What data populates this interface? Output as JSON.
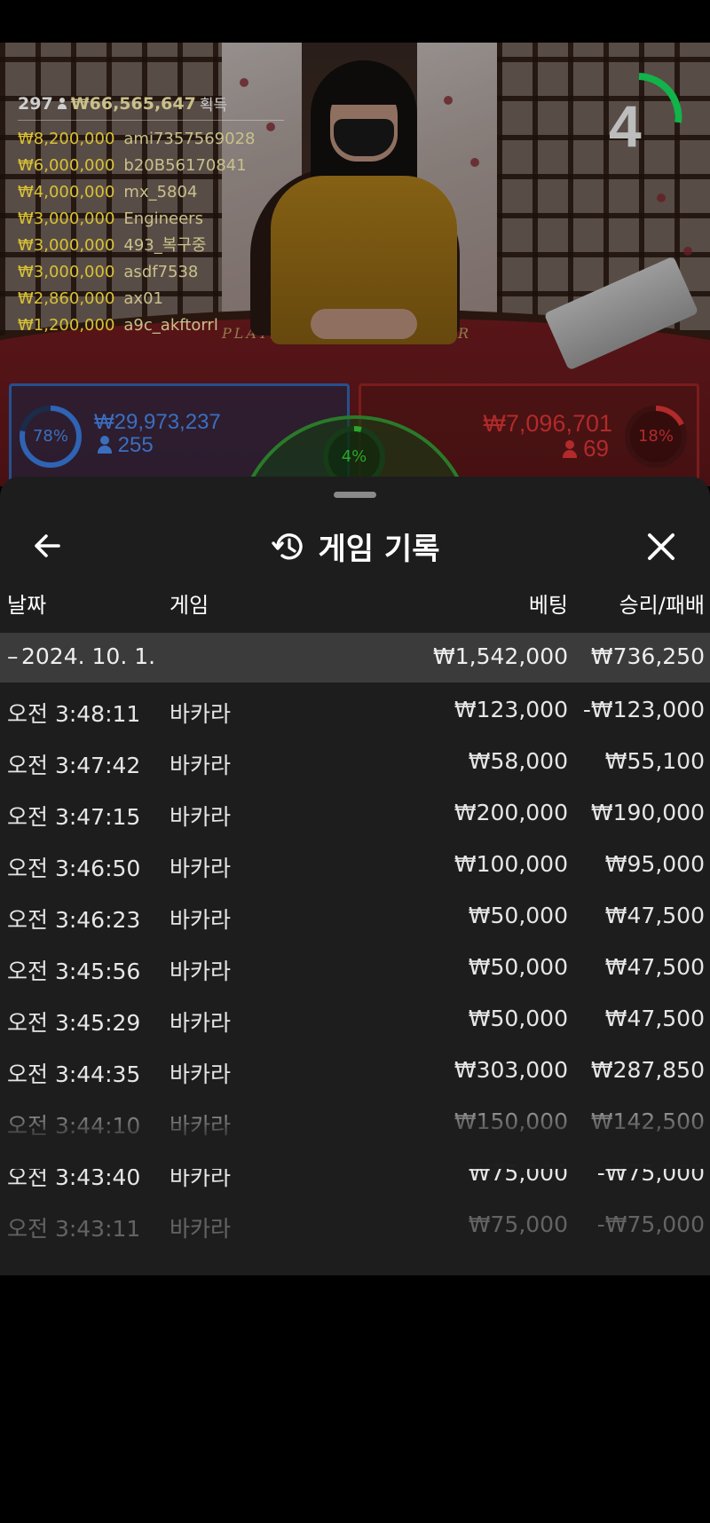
{
  "live": {
    "winners_summary": {
      "count": "297",
      "total": "₩66,565,647",
      "label": "획득"
    },
    "winners": [
      {
        "amount": "₩8,200,000",
        "user": "ami7357569028"
      },
      {
        "amount": "₩6,000,000",
        "user": "b20B56170841"
      },
      {
        "amount": "₩4,000,000",
        "user": "mx_5804"
      },
      {
        "amount": "₩3,000,000",
        "user": "Engineers"
      },
      {
        "amount": "₩3,000,000",
        "user": "493_복구중"
      },
      {
        "amount": "₩3,000,000",
        "user": "asdf7538"
      },
      {
        "amount": "₩2,860,000",
        "user": "ax01"
      },
      {
        "amount": "₩1,200,000",
        "user": "a9c_akftorrl"
      }
    ],
    "countdown": "4",
    "table_labels": {
      "player": "PLAYER",
      "banker": "BANKER"
    },
    "player": {
      "percent": "78%",
      "percent_value": 78,
      "amount": "₩29,973,237",
      "count": "255",
      "color": "#2f63b3"
    },
    "tie": {
      "percent": "4%",
      "percent_value": 4,
      "color": "#2aa52a"
    },
    "banker": {
      "percent": "18%",
      "percent_value": 18,
      "amount": "₩7,096,701",
      "count": "69",
      "color": "#b22a2a"
    }
  },
  "sheet": {
    "title": "게임 기록",
    "icons": {
      "back": "arrow-left-icon",
      "history": "history-icon",
      "close": "close-icon"
    },
    "columns": {
      "date": "날짜",
      "game": "게임",
      "bet": "베팅",
      "result": "승리/패배"
    },
    "date_group": {
      "toggle": "–",
      "date": "2024. 10. 1.",
      "bet_total": "₩1,542,000",
      "result_total": "₩736,250"
    },
    "rows": [
      {
        "time": "오전 3:48:11",
        "game": "바카라",
        "bet": "₩123,000",
        "result": "-₩123,000"
      },
      {
        "time": "오전 3:47:42",
        "game": "바카라",
        "bet": "₩58,000",
        "result": "₩55,100"
      },
      {
        "time": "오전 3:47:15",
        "game": "바카라",
        "bet": "₩200,000",
        "result": "₩190,000"
      },
      {
        "time": "오전 3:46:50",
        "game": "바카라",
        "bet": "₩100,000",
        "result": "₩95,000"
      },
      {
        "time": "오전 3:46:23",
        "game": "바카라",
        "bet": "₩50,000",
        "result": "₩47,500"
      },
      {
        "time": "오전 3:45:56",
        "game": "바카라",
        "bet": "₩50,000",
        "result": "₩47,500"
      },
      {
        "time": "오전 3:45:29",
        "game": "바카라",
        "bet": "₩50,000",
        "result": "₩47,500"
      },
      {
        "time": "오전 3:44:35",
        "game": "바카라",
        "bet": "₩303,000",
        "result": "₩287,850"
      },
      {
        "time": "오전 3:44:10",
        "game": "바카라",
        "bet": "₩150,000",
        "result": "₩142,500"
      },
      {
        "time": "오전 3:43:40",
        "game": "바카라",
        "bet": "₩75,000",
        "result": "-₩75,000"
      },
      {
        "time": "오전 3:43:11",
        "game": "바카라",
        "bet": "₩75,000",
        "result": "-₩75,000"
      }
    ]
  }
}
